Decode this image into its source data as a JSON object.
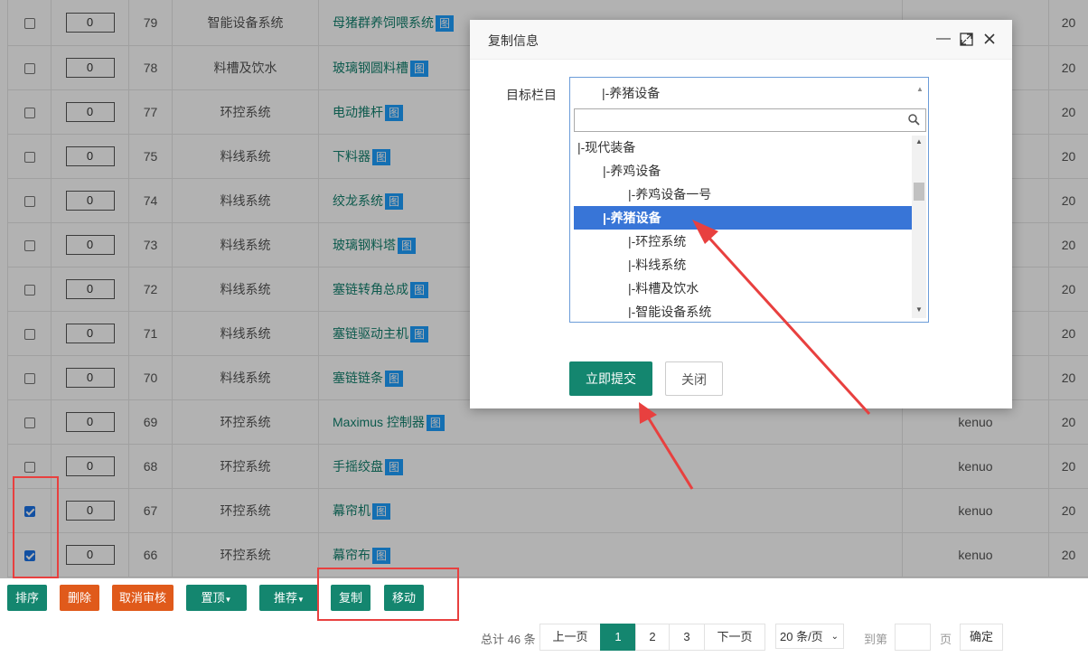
{
  "rows": [
    {
      "checked": false,
      "order": "0",
      "id": "79",
      "category": "智能设备系统",
      "title": "母猪群养饲喂系统",
      "img": "图",
      "author": "",
      "date_cut": "20"
    },
    {
      "checked": false,
      "order": "0",
      "id": "78",
      "category": "料槽及饮水",
      "title": "玻璃钢圆料槽",
      "img": "图",
      "author": "",
      "date_cut": "20"
    },
    {
      "checked": false,
      "order": "0",
      "id": "77",
      "category": "环控系统",
      "title": "电动推杆",
      "img": "图",
      "author": "",
      "date_cut": "20"
    },
    {
      "checked": false,
      "order": "0",
      "id": "75",
      "category": "料线系统",
      "title": "下料器",
      "img": "图",
      "author": "",
      "date_cut": "20"
    },
    {
      "checked": false,
      "order": "0",
      "id": "74",
      "category": "料线系统",
      "title": "绞龙系统",
      "img": "图",
      "author": "",
      "date_cut": "20"
    },
    {
      "checked": false,
      "order": "0",
      "id": "73",
      "category": "料线系统",
      "title": "玻璃钢料塔",
      "img": "图",
      "author": "",
      "date_cut": "20"
    },
    {
      "checked": false,
      "order": "0",
      "id": "72",
      "category": "料线系统",
      "title": "塞链转角总成",
      "img": "图",
      "author": "",
      "date_cut": "20"
    },
    {
      "checked": false,
      "order": "0",
      "id": "71",
      "category": "料线系统",
      "title": "塞链驱动主机",
      "img": "图",
      "author": "",
      "date_cut": "20"
    },
    {
      "checked": false,
      "order": "0",
      "id": "70",
      "category": "料线系统",
      "title": "塞链链条",
      "img": "图",
      "author": "",
      "date_cut": "20"
    },
    {
      "checked": false,
      "order": "0",
      "id": "69",
      "category": "环控系统",
      "title": "Maximus 控制器",
      "img": "图",
      "author": "kenuo",
      "date_cut": "20"
    },
    {
      "checked": false,
      "order": "0",
      "id": "68",
      "category": "环控系统",
      "title": "手摇绞盘",
      "img": "图",
      "author": "kenuo",
      "date_cut": "20"
    },
    {
      "checked": true,
      "order": "0",
      "id": "67",
      "category": "环控系统",
      "title": "幕帘机",
      "img": "图",
      "author": "kenuo",
      "date_cut": "20"
    },
    {
      "checked": true,
      "order": "0",
      "id": "66",
      "category": "环控系统",
      "title": "幕帘布",
      "img": "图",
      "author": "kenuo",
      "date_cut": "20"
    }
  ],
  "toolbar": {
    "sort": "排序",
    "delete": "删除",
    "cancel_review": "取消审核",
    "pin": "置顶",
    "recommend": "推荐",
    "copy": "复制",
    "move": "移动"
  },
  "pagination": {
    "total": "总计 46 条",
    "prev": "上一页",
    "pages": [
      "1",
      "2",
      "3"
    ],
    "current": "1",
    "next": "下一页",
    "page_size": "20 条/页",
    "goto_label": "到第",
    "goto_value": "",
    "page_unit": "页",
    "confirm": "确定"
  },
  "dialog": {
    "title": "复制信息",
    "field_label": "目标栏目",
    "selected": "|-养猪设备",
    "search_value": "",
    "options": [
      {
        "label": "|-现代装备",
        "indent": 0,
        "selected": false
      },
      {
        "label": "|-养鸡设备",
        "indent": 1,
        "selected": false
      },
      {
        "label": "|-养鸡设备一号",
        "indent": 2,
        "selected": false
      },
      {
        "label": "|-养猪设备",
        "indent": 1,
        "selected": true
      },
      {
        "label": "|-环控系统",
        "indent": 2,
        "selected": false
      },
      {
        "label": "|-料线系统",
        "indent": 2,
        "selected": false
      },
      {
        "label": "|-料槽及饮水",
        "indent": 2,
        "selected": false
      },
      {
        "label": "|-智能设备系统",
        "indent": 2,
        "selected": false
      }
    ],
    "submit": "立即提交",
    "close": "关闭"
  },
  "colors": {
    "teal": "#14866f",
    "orange": "#e05a1b",
    "highlight": "#e8403f",
    "select_blue": "#3875d7"
  }
}
